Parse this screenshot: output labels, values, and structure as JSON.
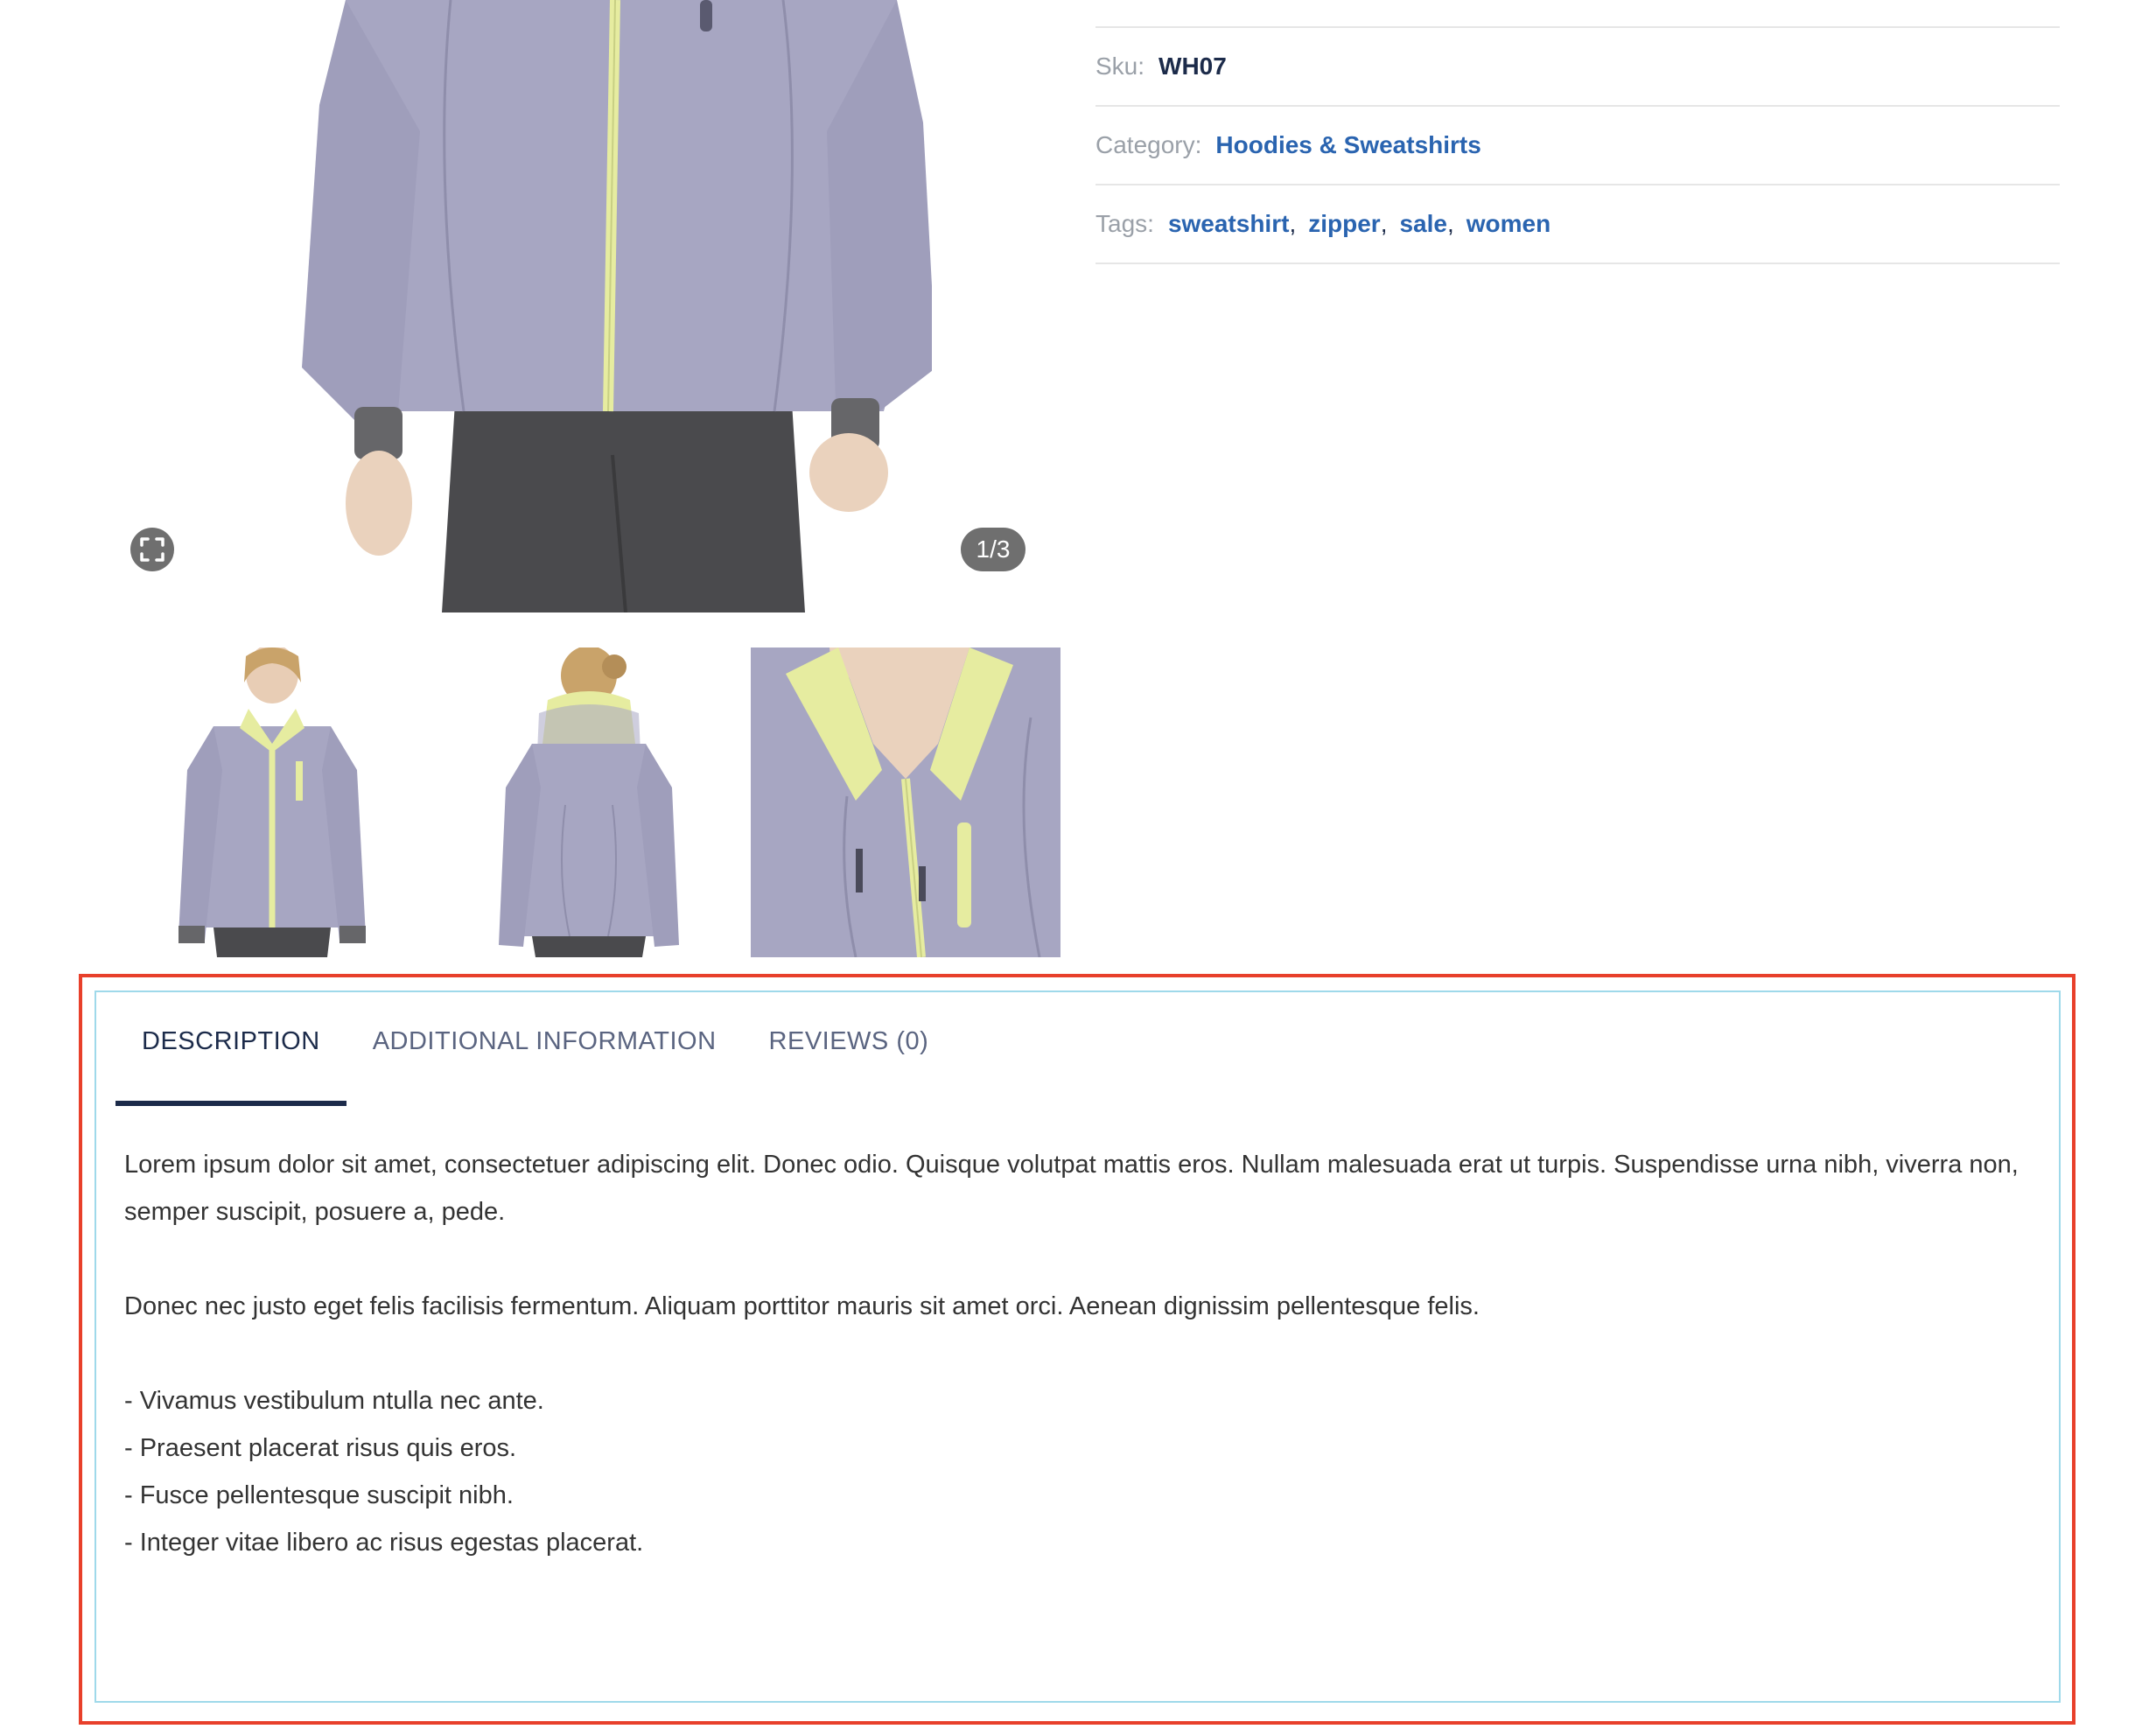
{
  "gallery": {
    "counter": "1/3",
    "fullscreen_icon": "fullscreen-icon",
    "thumbnails": [
      {
        "label": "front view"
      },
      {
        "label": "back view"
      },
      {
        "label": "detail view"
      }
    ]
  },
  "meta": {
    "sku_label": "Sku:",
    "sku_value": "WH07",
    "category_label": "Category:",
    "category_value": "Hoodies & Sweatshirts",
    "tags_label": "Tags:",
    "tags": [
      "sweatshirt",
      "zipper",
      "sale",
      "women"
    ],
    "tag_separator": ","
  },
  "tabs": {
    "items": [
      {
        "label": "DESCRIPTION",
        "active": true
      },
      {
        "label": "ADDITIONAL INFORMATION",
        "active": false
      },
      {
        "label": "REVIEWS (0)",
        "active": false
      }
    ]
  },
  "description": {
    "paragraph_1": "Lorem ipsum dolor sit amet, consectetuer adipiscing elit. Donec odio. Quisque volutpat mattis eros. Nullam malesuada erat ut turpis. Suspendisse urna nibh, viverra non, semper suscipit, posuere a, pede.",
    "paragraph_2": "Donec nec justo eget felis facilisis fermentum. Aliquam porttitor mauris sit amet orci. Aenean dignissim pellentesque felis.",
    "bullets": [
      "- Vivamus vestibulum ntulla nec ante.",
      "- Praesent placerat risus quis eros.",
      "- Fusce pellentesque suscipit nibh.",
      "- Integer vitae libero ac risus egestas placerat."
    ]
  },
  "colors": {
    "accent_link": "#2a64b0",
    "heading_dark": "#1c2b4a",
    "highlight_frame": "#e8402b",
    "panel_border": "#9fd9ea",
    "jacket": "#a7a6c2",
    "zipper": "#e6eca0"
  }
}
